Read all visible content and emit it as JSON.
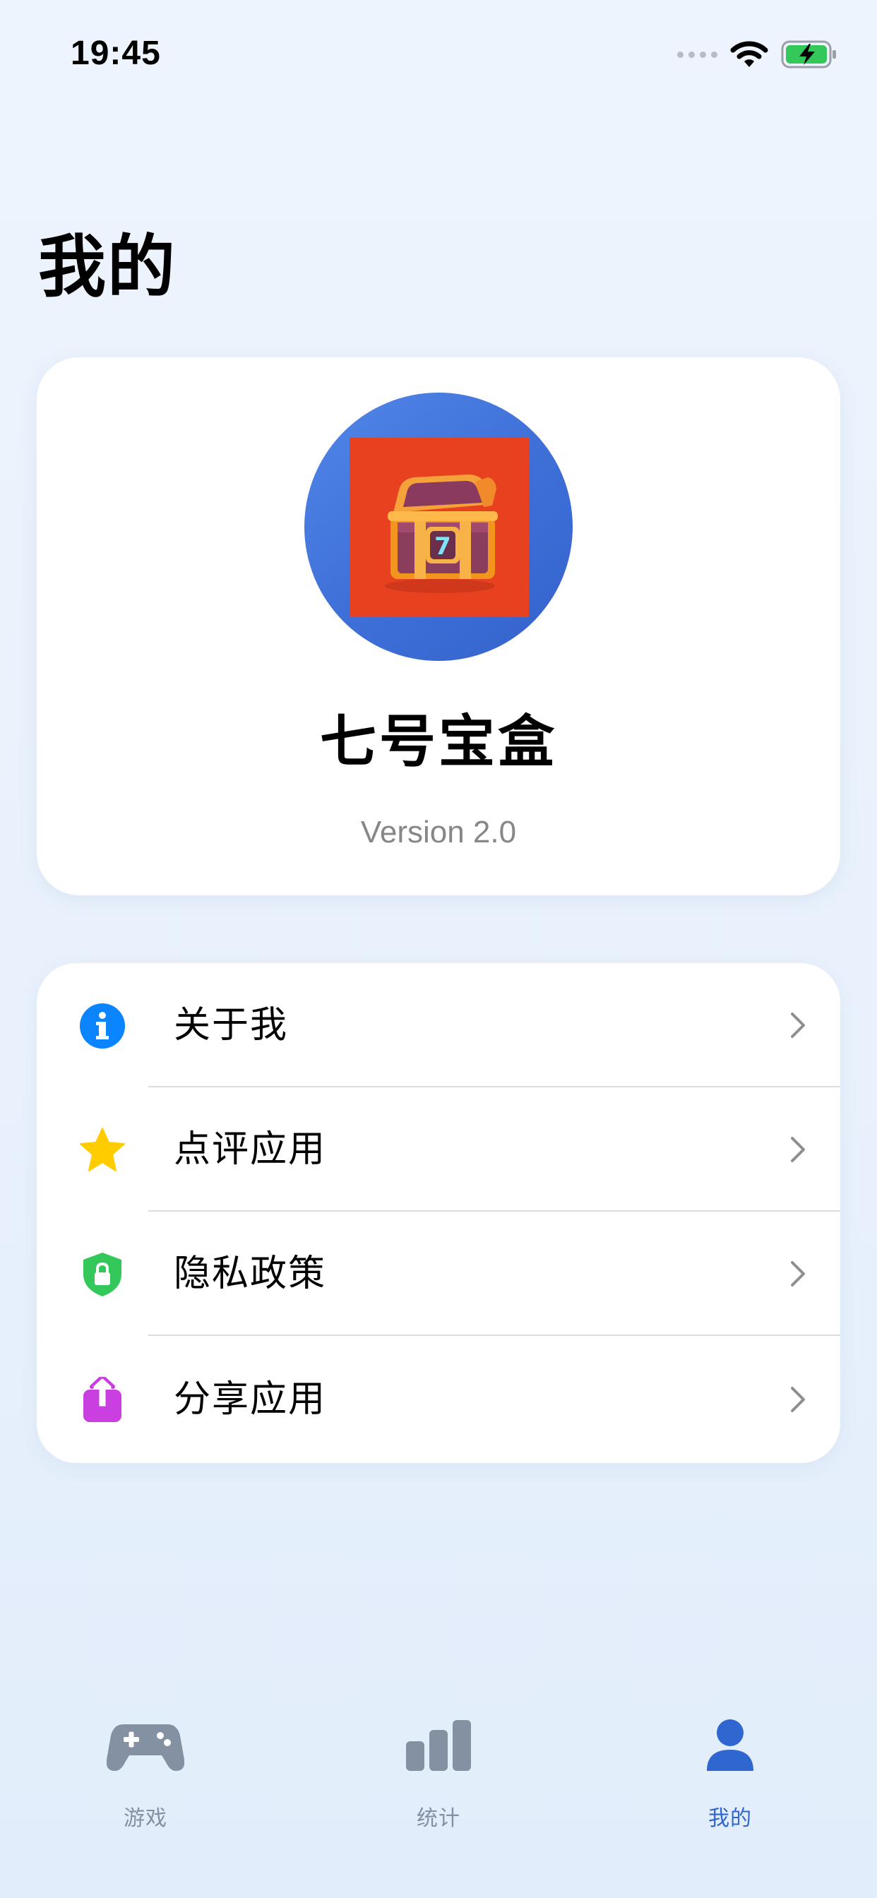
{
  "status_bar": {
    "time": "19:45"
  },
  "page": {
    "title": "我的"
  },
  "profile": {
    "app_name": "七号宝盒",
    "version": "Version 2.0",
    "icon_number": "7"
  },
  "menu": [
    {
      "label": "关于我",
      "icon": "info-icon",
      "color": "#0A84FF"
    },
    {
      "label": "点评应用",
      "icon": "star-icon",
      "color": "#FFCC00"
    },
    {
      "label": "隐私政策",
      "icon": "shield-lock-icon",
      "color": "#34C759"
    },
    {
      "label": "分享应用",
      "icon": "share-icon",
      "color": "#C93FE0"
    }
  ],
  "tabs": [
    {
      "label": "游戏",
      "icon": "gamepad-icon",
      "active": false
    },
    {
      "label": "统计",
      "icon": "bar-chart-icon",
      "active": false
    },
    {
      "label": "我的",
      "icon": "person-icon",
      "active": true
    }
  ],
  "colors": {
    "accent": "#2F66D0",
    "tab_inactive": "#8391A2",
    "secondary_text": "#86868B",
    "avatar_bg": "#3F70D8",
    "app_icon_bg": "#E8411F"
  }
}
